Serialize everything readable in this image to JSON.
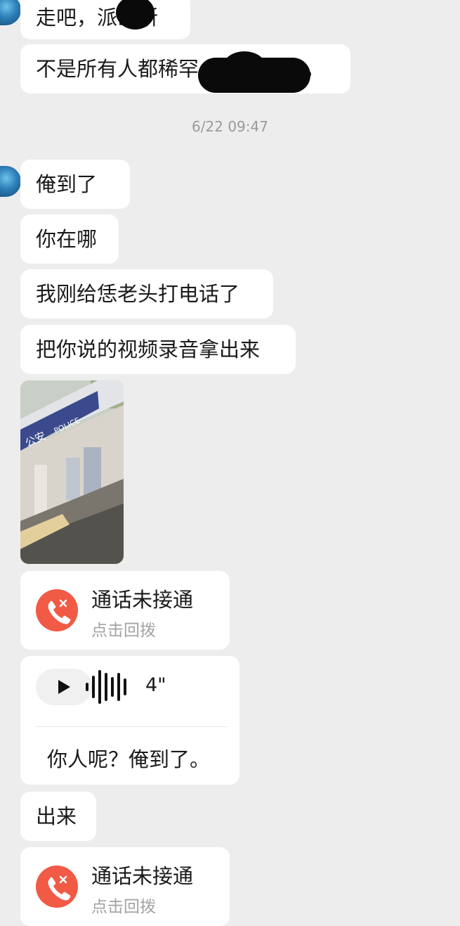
{
  "messages": {
    "m1": "走吧，派出所",
    "m2": "不是所有人都稀罕",
    "m2_end": "。",
    "timestamp": "6/22 09:47",
    "m3": "俺到了",
    "m4": "你在哪",
    "m5": "我刚给恁老头打电话了",
    "m6": "把你说的视频录音拿出来",
    "m8": "出来"
  },
  "photo": {
    "sign_text": "公安",
    "sign_text_2": "POLICE"
  },
  "missed_call_1": {
    "title": "通话未接通",
    "subtitle": "点击回拨"
  },
  "voice": {
    "duration": "4\"",
    "transcript": "你人呢？俺到了。"
  },
  "missed_call_2": {
    "title": "通话未接通",
    "subtitle": "点击回拨"
  },
  "colors": {
    "background": "#ededed",
    "bubble": "#ffffff",
    "call_icon": "#f15a45",
    "timestamp": "#9a9a9a"
  }
}
